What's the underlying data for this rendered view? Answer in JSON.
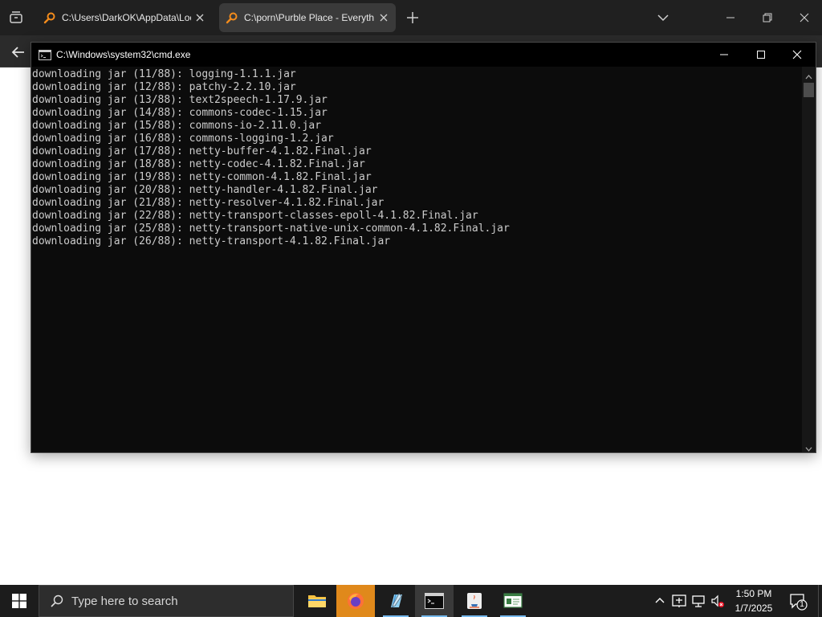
{
  "browser": {
    "tabs": [
      {
        "title": "C:\\Users\\DarkOK\\AppData\\Loc",
        "active": false
      },
      {
        "title": "C:\\porn\\Purble Place - Everyth",
        "active": true
      }
    ],
    "tab_icon": "search-icon"
  },
  "cmd": {
    "title": "C:\\Windows\\system32\\cmd.exe",
    "lines": [
      "downloading jar (11/88): logging-1.1.1.jar",
      "downloading jar (12/88): patchy-2.2.10.jar",
      "downloading jar (13/88): text2speech-1.17.9.jar",
      "downloading jar (14/88): commons-codec-1.15.jar",
      "downloading jar (15/88): commons-io-2.11.0.jar",
      "downloading jar (16/88): commons-logging-1.2.jar",
      "downloading jar (17/88): netty-buffer-4.1.82.Final.jar",
      "downloading jar (18/88): netty-codec-4.1.82.Final.jar",
      "downloading jar (19/88): netty-common-4.1.82.Final.jar",
      "downloading jar (20/88): netty-handler-4.1.82.Final.jar",
      "downloading jar (21/88): netty-resolver-4.1.82.Final.jar",
      "downloading jar (22/88): netty-transport-classes-epoll-4.1.82.Final.jar",
      "downloading jar (25/88): netty-transport-native-unix-common-4.1.82.Final.jar",
      "downloading jar (26/88): netty-transport-4.1.82.Final.jar"
    ]
  },
  "taskbar": {
    "search_placeholder": "Type here to search",
    "apps": [
      "file-explorer",
      "firefox",
      "notepad",
      "cmd",
      "java",
      "terminal-app"
    ],
    "active_app": "cmd",
    "clock_time": "1:50 PM",
    "clock_date": "1/7/2025",
    "notification_count": "1"
  }
}
